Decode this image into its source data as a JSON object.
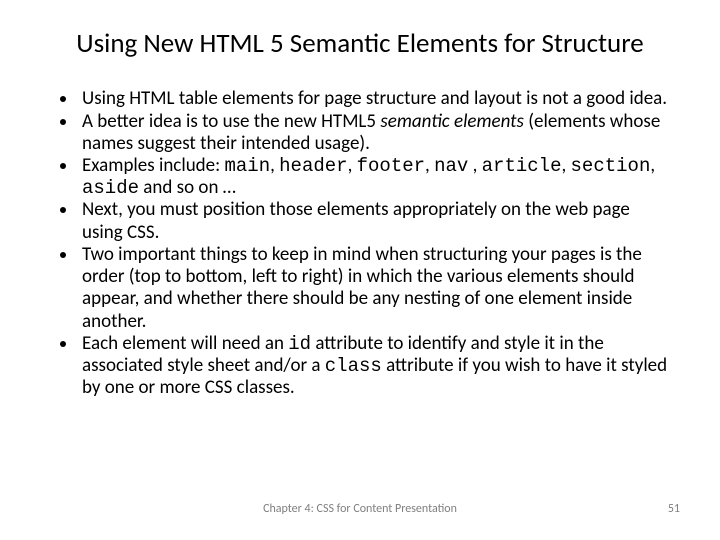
{
  "title": "Using New HTML 5 Semantic Elements for Structure",
  "bullets": {
    "b0": {
      "p0": "Using HTML table elements for page structure and layout is not a good idea."
    },
    "b1": {
      "p0": "A better idea is to use the new HTML5 ",
      "em": "semantic elements",
      "p1": " (elements whose names suggest their intended usage)."
    },
    "b2": {
      "p0": "Examples include: ",
      "c0": "main",
      "s0": ", ",
      "c1": "header",
      "s1": ", ",
      "c2": "footer",
      "s2": ", ",
      "c3": "nav",
      "s3": " , ",
      "c4": "article",
      "s4": ", ",
      "c5": "section",
      "s5": ", ",
      "c6": "aside",
      "p1": " and so on …"
    },
    "b3": {
      "p0": "Next, you must position those elements appropriately on the web page using CSS."
    },
    "b4": {
      "p0": "Two important things to keep in mind when structuring your pages is the order (top to bottom, left to right) in which the various elements should appear, and whether there should be any nesting of one element inside another."
    },
    "b5": {
      "p0": "Each element will need an ",
      "c0": "id",
      "p1": " attribute to identify and style it in the associated style sheet and/or a ",
      "c1": "class",
      "p2": " attribute if you wish to have it styled by one or more CSS classes."
    }
  },
  "footer": {
    "chapter": "Chapter 4: CSS for Content Presentation",
    "page": "51"
  }
}
